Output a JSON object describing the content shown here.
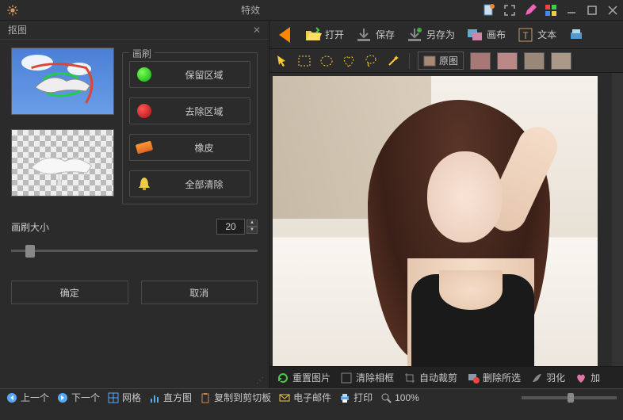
{
  "titlebar": {
    "title": "特效"
  },
  "panel": {
    "title": "抠图",
    "brush_legend": "画刷",
    "keep": "保留区域",
    "remove": "去除区域",
    "eraser": "橡皮",
    "clear": "全部清除",
    "size_label": "画刷大小",
    "size_value": "20",
    "ok": "确定",
    "cancel": "取消"
  },
  "toolbar": {
    "open": "打开",
    "save": "保存",
    "saveas": "另存为",
    "canvas": "画布",
    "text": "文本"
  },
  "toolbar2": {
    "orig": "原图"
  },
  "bottom": {
    "reset": "重置图片",
    "clearframe": "清除相框",
    "autocrop": "自动裁剪",
    "delsel": "删除所选",
    "feather": "羽化",
    "add": "加"
  },
  "status": {
    "prev": "上一个",
    "next": "下一个",
    "grid": "网格",
    "hist": "直方图",
    "clip": "复制到剪切板",
    "email": "电子邮件",
    "print": "打印",
    "zoom": "100%"
  }
}
